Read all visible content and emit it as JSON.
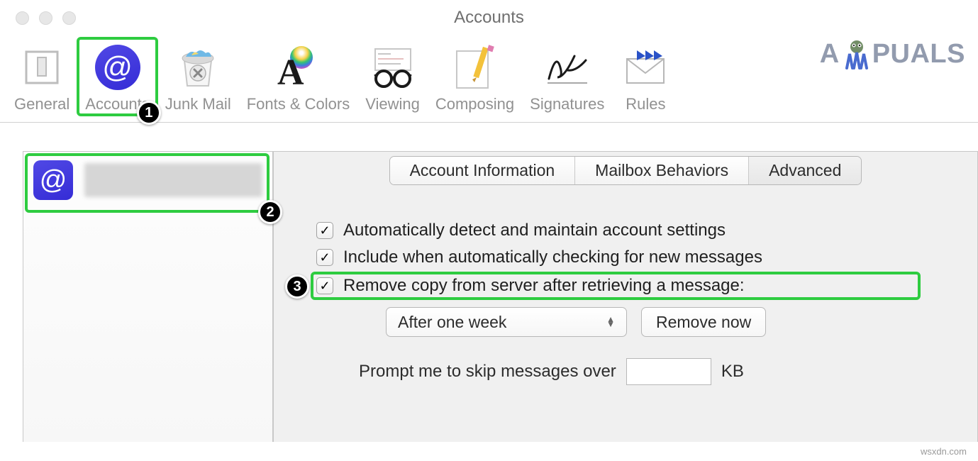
{
  "window": {
    "title": "Accounts"
  },
  "toolbar": {
    "general": "General",
    "accounts": "Accounts",
    "junk_mail": "Junk Mail",
    "fonts_colors": "Fonts & Colors",
    "viewing": "Viewing",
    "composing": "Composing",
    "signatures": "Signatures",
    "rules": "Rules"
  },
  "tabs": {
    "account_information": "Account Information",
    "mailbox_behaviors": "Mailbox Behaviors",
    "advanced": "Advanced"
  },
  "options": {
    "auto_detect": "Automatically detect and maintain account settings",
    "include_check": "Include when automatically checking for new messages",
    "remove_copy": "Remove copy from server after retrieving a message:"
  },
  "controls": {
    "period_selected": "After one week",
    "remove_now": "Remove now"
  },
  "prompt": {
    "label_before": "Prompt me to skip messages over",
    "label_after": "KB",
    "value": ""
  },
  "annotations": {
    "one": "1",
    "two": "2",
    "three": "3"
  },
  "watermark": {
    "prefix": "A",
    "suffix": "PUALS"
  },
  "footer": {
    "source": "wsxdn.com"
  }
}
